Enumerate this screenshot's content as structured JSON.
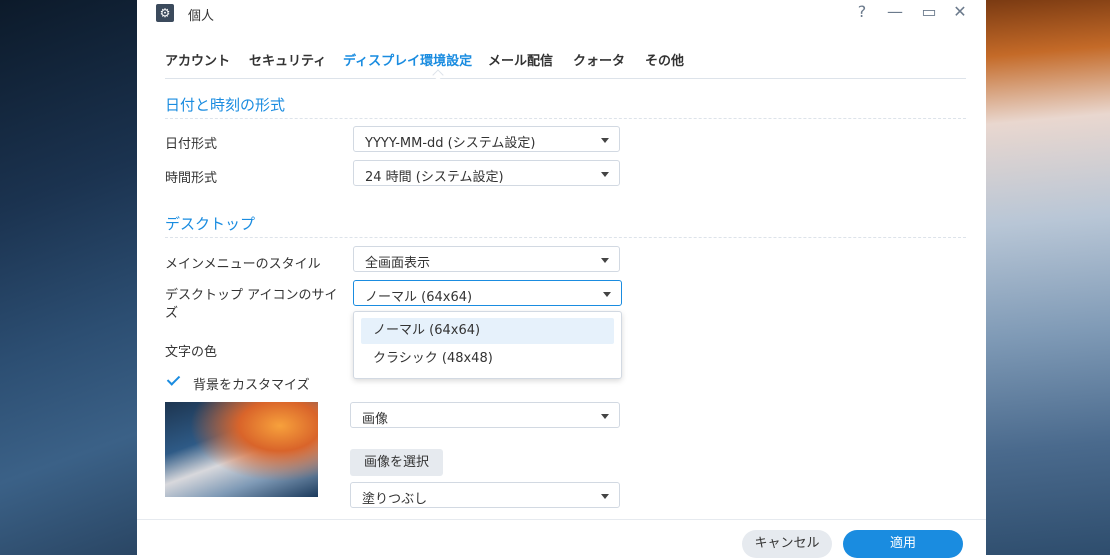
{
  "window": {
    "title": "個人",
    "controls": {
      "help": "?",
      "minimize": "—",
      "maximize": "▭",
      "close": "✕"
    }
  },
  "tabs": [
    {
      "label": "アカウント",
      "active": false
    },
    {
      "label": "セキュリティ",
      "active": false
    },
    {
      "label": "ディスプレイ環境設定",
      "active": true
    },
    {
      "label": "メール配信",
      "active": false
    },
    {
      "label": "クォータ",
      "active": false
    },
    {
      "label": "その他",
      "active": false
    }
  ],
  "sections": {
    "datetime": {
      "title": "日付と時刻の形式",
      "date_format": {
        "label": "日付形式",
        "value": "YYYY-MM-dd (システム設定)"
      },
      "time_format": {
        "label": "時間形式",
        "value": "24 時間 (システム設定)"
      }
    },
    "desktop": {
      "title": "デスクトップ",
      "menu_style": {
        "label": "メインメニューのスタイル",
        "value": "全画面表示"
      },
      "icon_size": {
        "label_line1": "デスクトップ アイコンのサイ",
        "label_line2": "ズ",
        "value": "ノーマル (64x64)",
        "options": [
          "ノーマル (64x64)",
          "クラシック (48x48)"
        ],
        "highlighted_option": "ノーマル (64x64)"
      },
      "text_color": {
        "label": "文字の色"
      },
      "custom_bg": {
        "label": "背景をカスタマイズ",
        "checked": true
      },
      "bg_type": {
        "value": "画像"
      },
      "select_image_button": "画像を選択",
      "fill_mode": {
        "value": "塗りつぶし"
      }
    }
  },
  "footer": {
    "cancel": "キャンセル",
    "apply": "適用"
  },
  "colors": {
    "accent": "#1a8ce0",
    "text": "#333333",
    "border": "#d2d9e2"
  }
}
